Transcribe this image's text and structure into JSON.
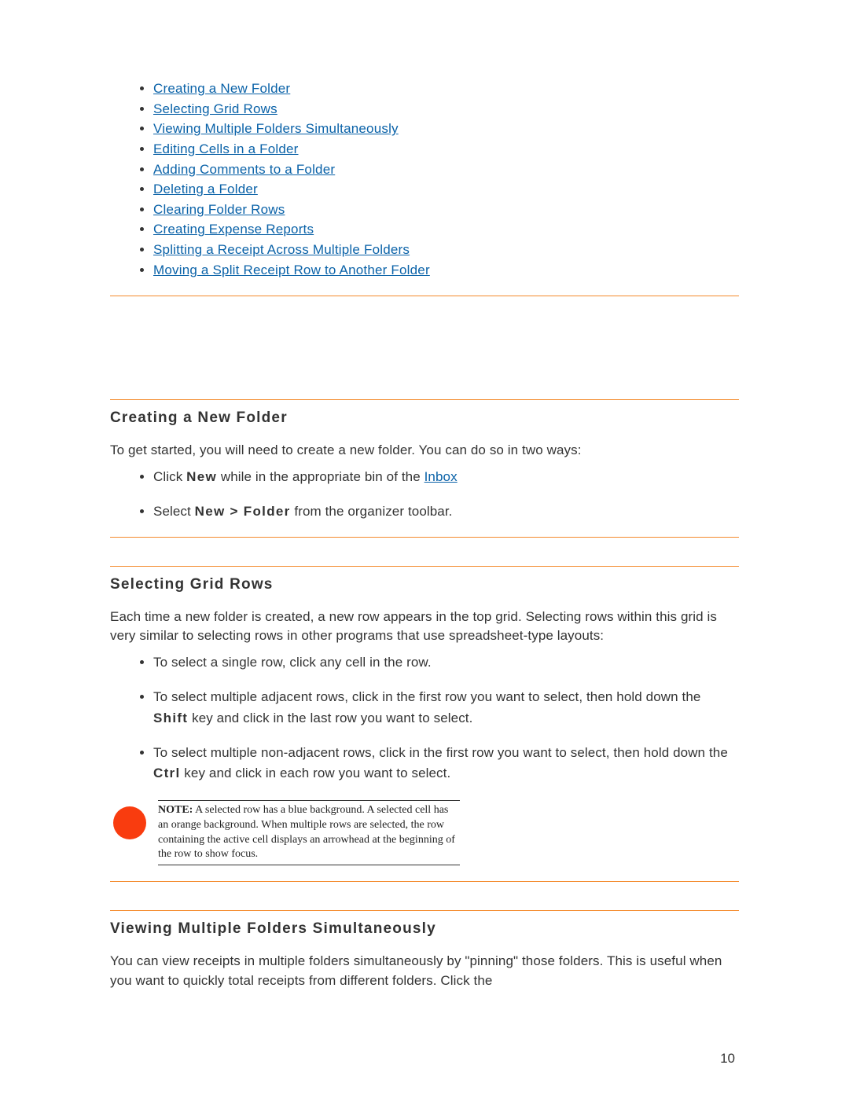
{
  "toc": [
    "Creating a New Folder",
    "Selecting Grid Rows",
    "Viewing Multiple Folders Simultaneously",
    "Editing Cells in a Folder",
    "Adding Comments to a Folder",
    "Deleting a Folder",
    "Clearing Folder Rows",
    "Creating Expense Reports",
    "Splitting a Receipt Across Multiple Folders",
    "Moving a Split Receipt Row to Another Folder"
  ],
  "section1": {
    "title": "Creating a New Folder",
    "intro": "To get started, you will need to create a new folder. You can do so in two ways:",
    "b1_pre": "Click ",
    "b1_kw": "New",
    "b1_mid": "  while in the appropriate bin of the ",
    "b1_link": "Inbox",
    "b2_pre": "Select ",
    "b2_kw": "New > Folder",
    "b2_post": " from the organizer toolbar."
  },
  "section2": {
    "title": "Selecting Grid Rows",
    "intro": "Each time a new folder is created, a new row appears in the top grid. Selecting rows within this grid is very similar to selecting rows in other programs that use spreadsheet-type layouts:",
    "b1": "To select a single row, click any cell in the row.",
    "b2_pre": "To select multiple adjacent rows, click in the first row you want to select, then hold down the ",
    "b2_kw": "Shift",
    "b2_post": " key and click in the last row you want to select.",
    "b3_pre": "To select multiple non-adjacent rows, click in the first row you want to select, then hold down the ",
    "b3_kw": "Ctrl",
    "b3_post": " key and click in each row you want to select.",
    "note_label": "NOTE:",
    "note_body": " A selected row has a blue background. A selected cell has an orange background. When multiple rows are selected, the row containing the active cell displays an arrowhead at the beginning of the row to show focus."
  },
  "section3": {
    "title": "Viewing Multiple Folders Simultaneously",
    "body": "You can view receipts in multiple folders simultaneously by \"pinning\" those folders. This is useful when you want to quickly total receipts from different folders. Click the"
  },
  "page_number": "10"
}
